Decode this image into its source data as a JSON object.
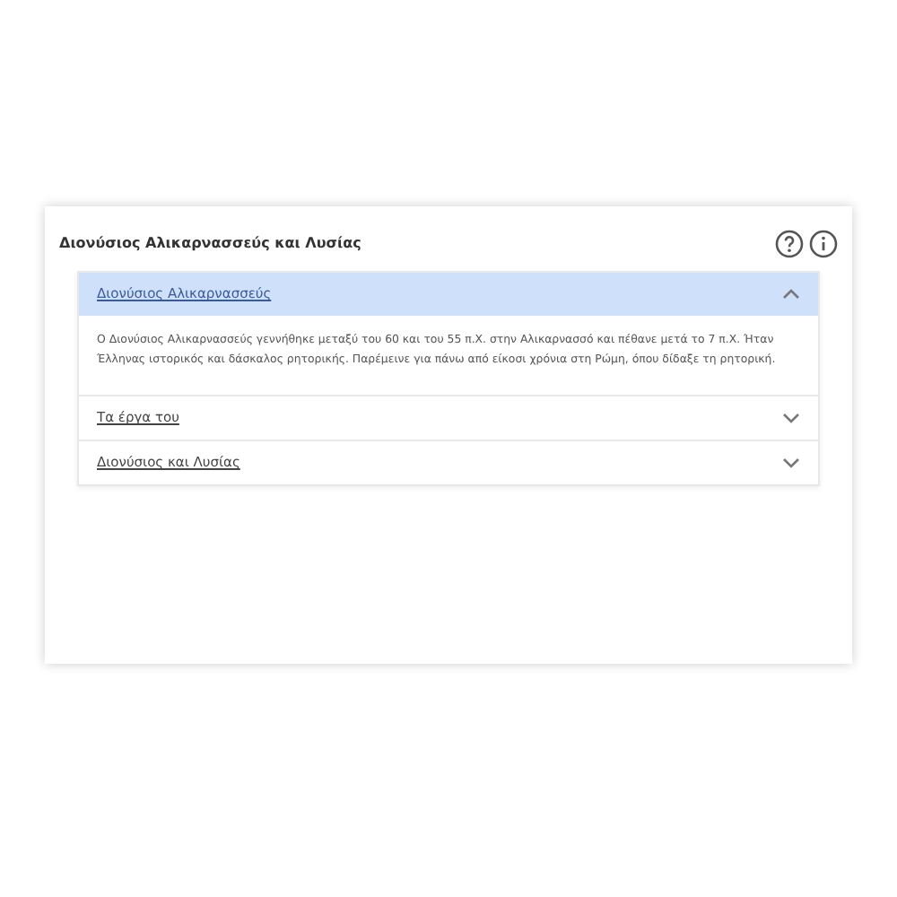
{
  "card": {
    "title": "Διονύσιος Αλικαρνασσεύς και Λυσίας"
  },
  "accordion": [
    {
      "title": "Διονύσιος Αλικαρνασσεύς",
      "expanded": true,
      "body": "Ο Διονύσιος Αλικαρνασσεύς γεννήθηκε μεταξύ του 60 και του 55 π.Χ. στην Αλικαρνασσό και πέθανε μετά το 7 π.Χ. Ήταν Έλληνας ιστορικός και δάσκαλος ρητορικής. Παρέμεινε για πάνω από είκοσι χρόνια στη Ρώμη, όπου δίδαξε τη ρητορική."
    },
    {
      "title": "Τα έργα του",
      "expanded": false
    },
    {
      "title": "Διονύσιος και Λυσίας",
      "expanded": false
    }
  ]
}
